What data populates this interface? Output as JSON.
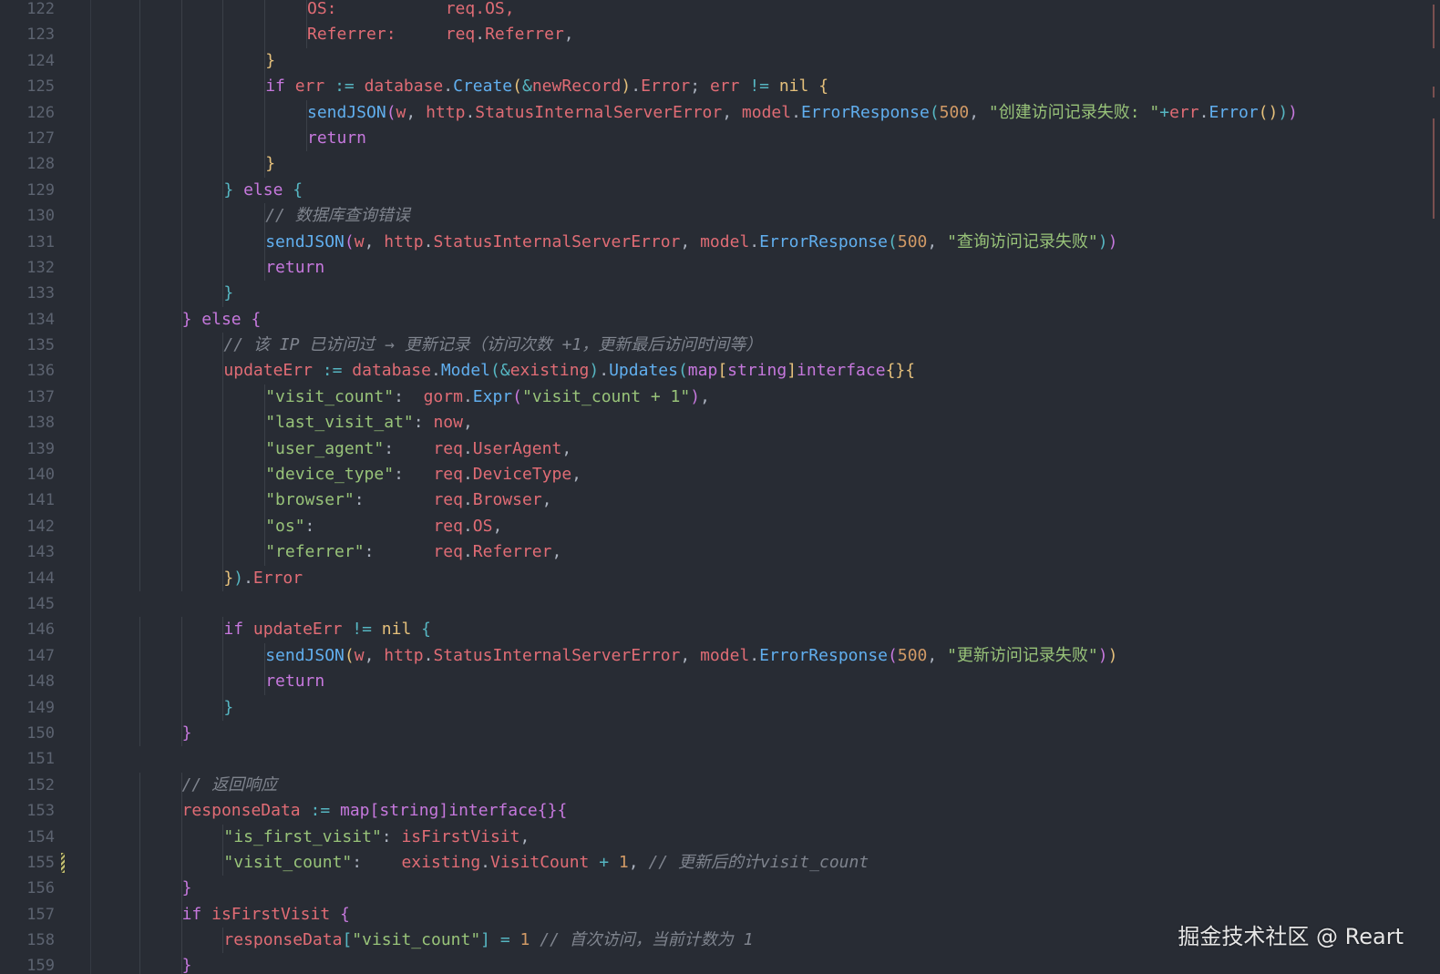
{
  "editor": {
    "first_line_number": 122,
    "lines": [
      {
        "indent": 6,
        "tokens": [
          [
            "v",
            "OS:           req.OS,"
          ]
        ]
      },
      {
        "indent": 6,
        "tokens": [
          [
            "v",
            "Referrer:"
          ],
          [
            "p",
            "     "
          ],
          [
            "v",
            "req"
          ],
          [
            "p",
            "."
          ],
          [
            "v",
            "Referrer"
          ],
          [
            "p",
            ","
          ]
        ]
      },
      {
        "indent": 5,
        "tokens": [
          [
            "b1",
            "}"
          ]
        ]
      },
      {
        "indent": 5,
        "tokens": [
          [
            "k",
            "if "
          ],
          [
            "v",
            "err "
          ],
          [
            "op",
            ":= "
          ],
          [
            "v",
            "database"
          ],
          [
            "p",
            "."
          ],
          [
            "f",
            "Create"
          ],
          [
            "b1",
            "("
          ],
          [
            "op",
            "&"
          ],
          [
            "v",
            "newRecord"
          ],
          [
            "b1",
            ")"
          ],
          [
            "p",
            "."
          ],
          [
            "v",
            "Error"
          ],
          [
            "p",
            "; "
          ],
          [
            "v",
            "err "
          ],
          [
            "op",
            "!= "
          ],
          [
            "t",
            "nil "
          ],
          [
            "b1",
            "{"
          ]
        ]
      },
      {
        "indent": 6,
        "tokens": [
          [
            "f",
            "sendJSON"
          ],
          [
            "b2",
            "("
          ],
          [
            "v",
            "w"
          ],
          [
            "p",
            ", "
          ],
          [
            "v",
            "http"
          ],
          [
            "p",
            "."
          ],
          [
            "v",
            "StatusInternalServerError"
          ],
          [
            "p",
            ", "
          ],
          [
            "v",
            "model"
          ],
          [
            "p",
            "."
          ],
          [
            "f",
            "ErrorResponse"
          ],
          [
            "b3",
            "("
          ],
          [
            "n",
            "500"
          ],
          [
            "p",
            ", "
          ],
          [
            "s",
            "\"创建访问记录失败: \""
          ],
          [
            "op",
            "+"
          ],
          [
            "v",
            "err"
          ],
          [
            "p",
            "."
          ],
          [
            "f",
            "Error"
          ],
          [
            "b1",
            "()"
          ],
          [
            "b3",
            ")"
          ],
          [
            "b2",
            ")"
          ]
        ]
      },
      {
        "indent": 6,
        "tokens": [
          [
            "k",
            "return"
          ]
        ]
      },
      {
        "indent": 5,
        "tokens": [
          [
            "b1",
            "}"
          ]
        ]
      },
      {
        "indent": 4,
        "tokens": [
          [
            "b3",
            "} "
          ],
          [
            "k",
            "else "
          ],
          [
            "b3",
            "{"
          ]
        ]
      },
      {
        "indent": 5,
        "tokens": [
          [
            "c",
            "// 数据库查询错误"
          ]
        ]
      },
      {
        "indent": 5,
        "tokens": [
          [
            "f",
            "sendJSON"
          ],
          [
            "b2",
            "("
          ],
          [
            "v",
            "w"
          ],
          [
            "p",
            ", "
          ],
          [
            "v",
            "http"
          ],
          [
            "p",
            "."
          ],
          [
            "v",
            "StatusInternalServerError"
          ],
          [
            "p",
            ", "
          ],
          [
            "v",
            "model"
          ],
          [
            "p",
            "."
          ],
          [
            "f",
            "ErrorResponse"
          ],
          [
            "b3",
            "("
          ],
          [
            "n",
            "500"
          ],
          [
            "p",
            ", "
          ],
          [
            "s",
            "\"查询访问记录失败\""
          ],
          [
            "b3",
            ")"
          ],
          [
            "b2",
            ")"
          ]
        ]
      },
      {
        "indent": 5,
        "tokens": [
          [
            "k",
            "return"
          ]
        ]
      },
      {
        "indent": 4,
        "tokens": [
          [
            "b3",
            "}"
          ]
        ]
      },
      {
        "indent": 3,
        "tokens": [
          [
            "b2",
            "} "
          ],
          [
            "k",
            "else "
          ],
          [
            "b2",
            "{"
          ]
        ]
      },
      {
        "indent": 4,
        "tokens": [
          [
            "c",
            "// 该 IP 已访问过 → 更新记录（访问次数 +1，更新最后访问时间等）"
          ]
        ]
      },
      {
        "indent": 4,
        "tokens": [
          [
            "v",
            "updateErr "
          ],
          [
            "op",
            ":= "
          ],
          [
            "v",
            "database"
          ],
          [
            "p",
            "."
          ],
          [
            "f",
            "Model"
          ],
          [
            "b3",
            "("
          ],
          [
            "op",
            "&"
          ],
          [
            "v",
            "existing"
          ],
          [
            "b3",
            ")"
          ],
          [
            "p",
            "."
          ],
          [
            "f",
            "Updates"
          ],
          [
            "b3",
            "("
          ],
          [
            "k",
            "map"
          ],
          [
            "b1",
            "["
          ],
          [
            "k",
            "string"
          ],
          [
            "b1",
            "]"
          ],
          [
            "k",
            "interface"
          ],
          [
            "b1",
            "{}{"
          ]
        ]
      },
      {
        "indent": 5,
        "tokens": [
          [
            "s",
            "\"visit_count\""
          ],
          [
            "p",
            ":  "
          ],
          [
            "v",
            "gorm"
          ],
          [
            "p",
            "."
          ],
          [
            "f",
            "Expr"
          ],
          [
            "b2",
            "("
          ],
          [
            "s",
            "\"visit_count + 1\""
          ],
          [
            "b2",
            ")"
          ],
          [
            "p",
            ","
          ]
        ]
      },
      {
        "indent": 5,
        "tokens": [
          [
            "s",
            "\"last_visit_at\""
          ],
          [
            "p",
            ": "
          ],
          [
            "v",
            "now"
          ],
          [
            "p",
            ","
          ]
        ]
      },
      {
        "indent": 5,
        "tokens": [
          [
            "s",
            "\"user_agent\""
          ],
          [
            "p",
            ":    "
          ],
          [
            "v",
            "req"
          ],
          [
            "p",
            "."
          ],
          [
            "v",
            "UserAgent"
          ],
          [
            "p",
            ","
          ]
        ]
      },
      {
        "indent": 5,
        "tokens": [
          [
            "s",
            "\"device_type\""
          ],
          [
            "p",
            ":   "
          ],
          [
            "v",
            "req"
          ],
          [
            "p",
            "."
          ],
          [
            "v",
            "DeviceType"
          ],
          [
            "p",
            ","
          ]
        ]
      },
      {
        "indent": 5,
        "tokens": [
          [
            "s",
            "\"browser\""
          ],
          [
            "p",
            ":       "
          ],
          [
            "v",
            "req"
          ],
          [
            "p",
            "."
          ],
          [
            "v",
            "Browser"
          ],
          [
            "p",
            ","
          ]
        ]
      },
      {
        "indent": 5,
        "tokens": [
          [
            "s",
            "\"os\""
          ],
          [
            "p",
            ":            "
          ],
          [
            "v",
            "req"
          ],
          [
            "p",
            "."
          ],
          [
            "v",
            "OS"
          ],
          [
            "p",
            ","
          ]
        ]
      },
      {
        "indent": 5,
        "tokens": [
          [
            "s",
            "\"referrer\""
          ],
          [
            "p",
            ":      "
          ],
          [
            "v",
            "req"
          ],
          [
            "p",
            "."
          ],
          [
            "v",
            "Referrer"
          ],
          [
            "p",
            ","
          ]
        ]
      },
      {
        "indent": 4,
        "tokens": [
          [
            "b1",
            "}"
          ],
          [
            "b3",
            ")"
          ],
          [
            "p",
            "."
          ],
          [
            "v",
            "Error"
          ]
        ]
      },
      {
        "indent": 0,
        "tokens": []
      },
      {
        "indent": 4,
        "tokens": [
          [
            "k",
            "if "
          ],
          [
            "v",
            "updateErr "
          ],
          [
            "op",
            "!= "
          ],
          [
            "t",
            "nil "
          ],
          [
            "b3",
            "{"
          ]
        ]
      },
      {
        "indent": 5,
        "tokens": [
          [
            "f",
            "sendJSON"
          ],
          [
            "b1",
            "("
          ],
          [
            "v",
            "w"
          ],
          [
            "p",
            ", "
          ],
          [
            "v",
            "http"
          ],
          [
            "p",
            "."
          ],
          [
            "v",
            "StatusInternalServerError"
          ],
          [
            "p",
            ", "
          ],
          [
            "v",
            "model"
          ],
          [
            "p",
            "."
          ],
          [
            "f",
            "ErrorResponse"
          ],
          [
            "b2",
            "("
          ],
          [
            "n",
            "500"
          ],
          [
            "p",
            ", "
          ],
          [
            "s",
            "\"更新访问记录失败\""
          ],
          [
            "b2",
            ")"
          ],
          [
            "b1",
            ")"
          ]
        ]
      },
      {
        "indent": 5,
        "tokens": [
          [
            "k",
            "return"
          ]
        ]
      },
      {
        "indent": 4,
        "tokens": [
          [
            "b3",
            "}"
          ]
        ]
      },
      {
        "indent": 3,
        "tokens": [
          [
            "b2",
            "}"
          ]
        ]
      },
      {
        "indent": 0,
        "tokens": []
      },
      {
        "indent": 3,
        "tokens": [
          [
            "c",
            "// 返回响应"
          ]
        ]
      },
      {
        "indent": 3,
        "tokens": [
          [
            "v",
            "responseData "
          ],
          [
            "op",
            ":= "
          ],
          [
            "k",
            "map"
          ],
          [
            "b2",
            "["
          ],
          [
            "k",
            "string"
          ],
          [
            "b2",
            "]"
          ],
          [
            "k",
            "interface"
          ],
          [
            "b2",
            "{}{"
          ]
        ]
      },
      {
        "indent": 4,
        "tokens": [
          [
            "s",
            "\"is_first_visit\""
          ],
          [
            "p",
            ": "
          ],
          [
            "v",
            "isFirstVisit"
          ],
          [
            "p",
            ","
          ]
        ]
      },
      {
        "indent": 4,
        "tokens": [
          [
            "s",
            "\"visit_count\""
          ],
          [
            "p",
            ":    "
          ],
          [
            "v",
            "existing"
          ],
          [
            "p",
            "."
          ],
          [
            "v",
            "VisitCount "
          ],
          [
            "op",
            "+ "
          ],
          [
            "n",
            "1"
          ],
          [
            "p",
            ", "
          ],
          [
            "c",
            "// 更新后的计visit_count"
          ]
        ],
        "modified": true
      },
      {
        "indent": 3,
        "tokens": [
          [
            "b2",
            "}"
          ]
        ]
      },
      {
        "indent": 3,
        "tokens": [
          [
            "k",
            "if "
          ],
          [
            "v",
            "isFirstVisit "
          ],
          [
            "b2",
            "{"
          ]
        ]
      },
      {
        "indent": 4,
        "tokens": [
          [
            "v",
            "responseData"
          ],
          [
            "b3",
            "["
          ],
          [
            "s",
            "\"visit_count\""
          ],
          [
            "b3",
            "] "
          ],
          [
            "op",
            "= "
          ],
          [
            "n",
            "1 "
          ],
          [
            "c",
            "// 首次访问，当前计数为 1"
          ]
        ]
      },
      {
        "indent": 3,
        "tokens": [
          [
            "b2",
            "}"
          ]
        ]
      }
    ]
  },
  "watermark": "掘金技术社区 @ Reart",
  "colors": {
    "background": "#282c34",
    "keyword": "#c678dd",
    "variable": "#e06c75",
    "function": "#61afef",
    "string": "#98c379",
    "number": "#d19a66",
    "comment": "#7f848e"
  }
}
